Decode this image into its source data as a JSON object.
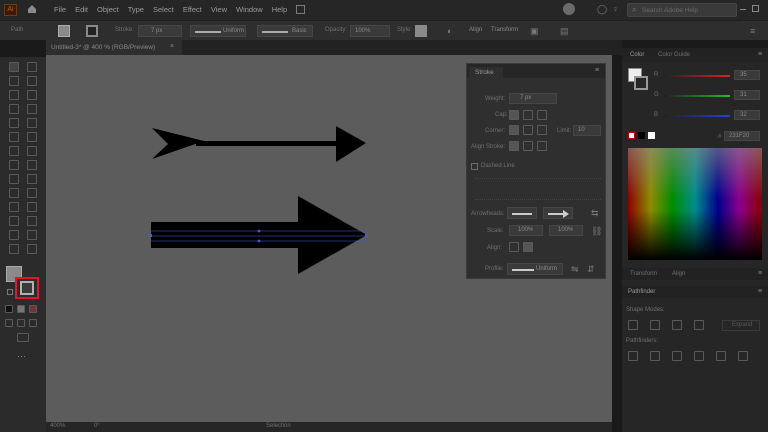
{
  "menu": [
    "File",
    "Edit",
    "Object",
    "Type",
    "Select",
    "Effect",
    "View",
    "Window",
    "Help"
  ],
  "search_placeholder": "Search Adobe Help",
  "control": {
    "context": "Path",
    "stroke_label": "Stroke:",
    "stroke_weight": "7 px",
    "profile1": "Uniform",
    "profile2": "Basic",
    "opacity_label": "Opacity:",
    "opacity": "100%",
    "style_label": "Style:",
    "align": "Align",
    "transform": "Transform"
  },
  "doc_tab": "Untitled-3* @ 400 % (RGB/Preview)",
  "stroke_panel": {
    "title": "Stroke",
    "weight_label": "Weight:",
    "weight": "7 px",
    "cap_label": "Cap:",
    "corner_label": "Corner:",
    "limit_label": "Limit:",
    "limit": "10",
    "align_label": "Align Stroke:",
    "dashed": "Dashed Line",
    "arrowheads_label": "Arrowheads:",
    "scale_label": "Scale:",
    "scale1": "100%",
    "scale2": "100%",
    "align2_label": "Align:",
    "profile_label": "Profile:",
    "profile": "Uniform"
  },
  "color_panel": {
    "tab_color": "Color",
    "tab_gradient": "Color Guide",
    "r": "35",
    "g": "31",
    "b": "32",
    "hex": "231F20"
  },
  "transform_tab": "Transform",
  "align_tab": "Align",
  "pathfinder": {
    "title": "Pathfinder",
    "shape_modes": "Shape Modes:",
    "pathfinders": "Pathfinders:",
    "expand": "Expand"
  },
  "status": {
    "zoom": "400%",
    "angle": "0°",
    "tool": "Selection"
  },
  "colors": {
    "accent": "#e8102a",
    "canvas": "#5c5c5c"
  }
}
